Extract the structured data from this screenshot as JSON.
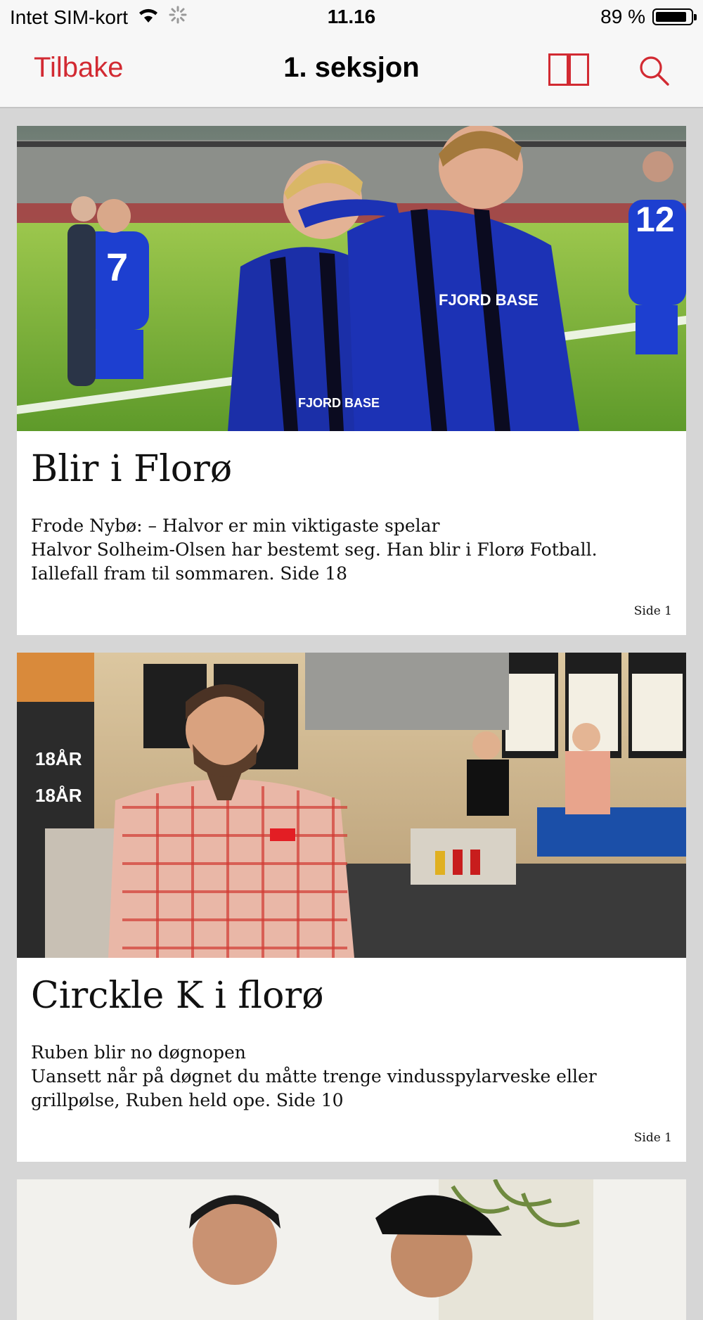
{
  "status_bar": {
    "carrier": "Intet SIM-kort",
    "time": "11.16",
    "battery_percent": "89 %",
    "battery_level": 0.89
  },
  "nav": {
    "back_label": "Tilbake",
    "title": "1. seksjon",
    "icons": [
      "page-view-icon",
      "search-icon"
    ]
  },
  "colors": {
    "accent": "#d22a32",
    "background": "#d6d6d6",
    "bar": "#f7f7f7"
  },
  "articles": [
    {
      "title": "Blir i Florø",
      "lead": "Frode Nybø: – Halvor er min viktigaste spelar",
      "body_lines": [
        "Halvor Solheim-Olsen har bestemt seg. Han blir i Florø Fotball.",
        "Iallefall fram til sommaren. Side 18"
      ],
      "page_label": "Side 1"
    },
    {
      "title": "Circkle K i florø",
      "lead": "Ruben blir no døgnopen",
      "body_lines": [
        "Uansett når på døgnet du måtte trenge vindusspylarveske eller",
        "grillpølse, Ruben held ope. Side 10"
      ],
      "page_label": "Side 1"
    }
  ]
}
